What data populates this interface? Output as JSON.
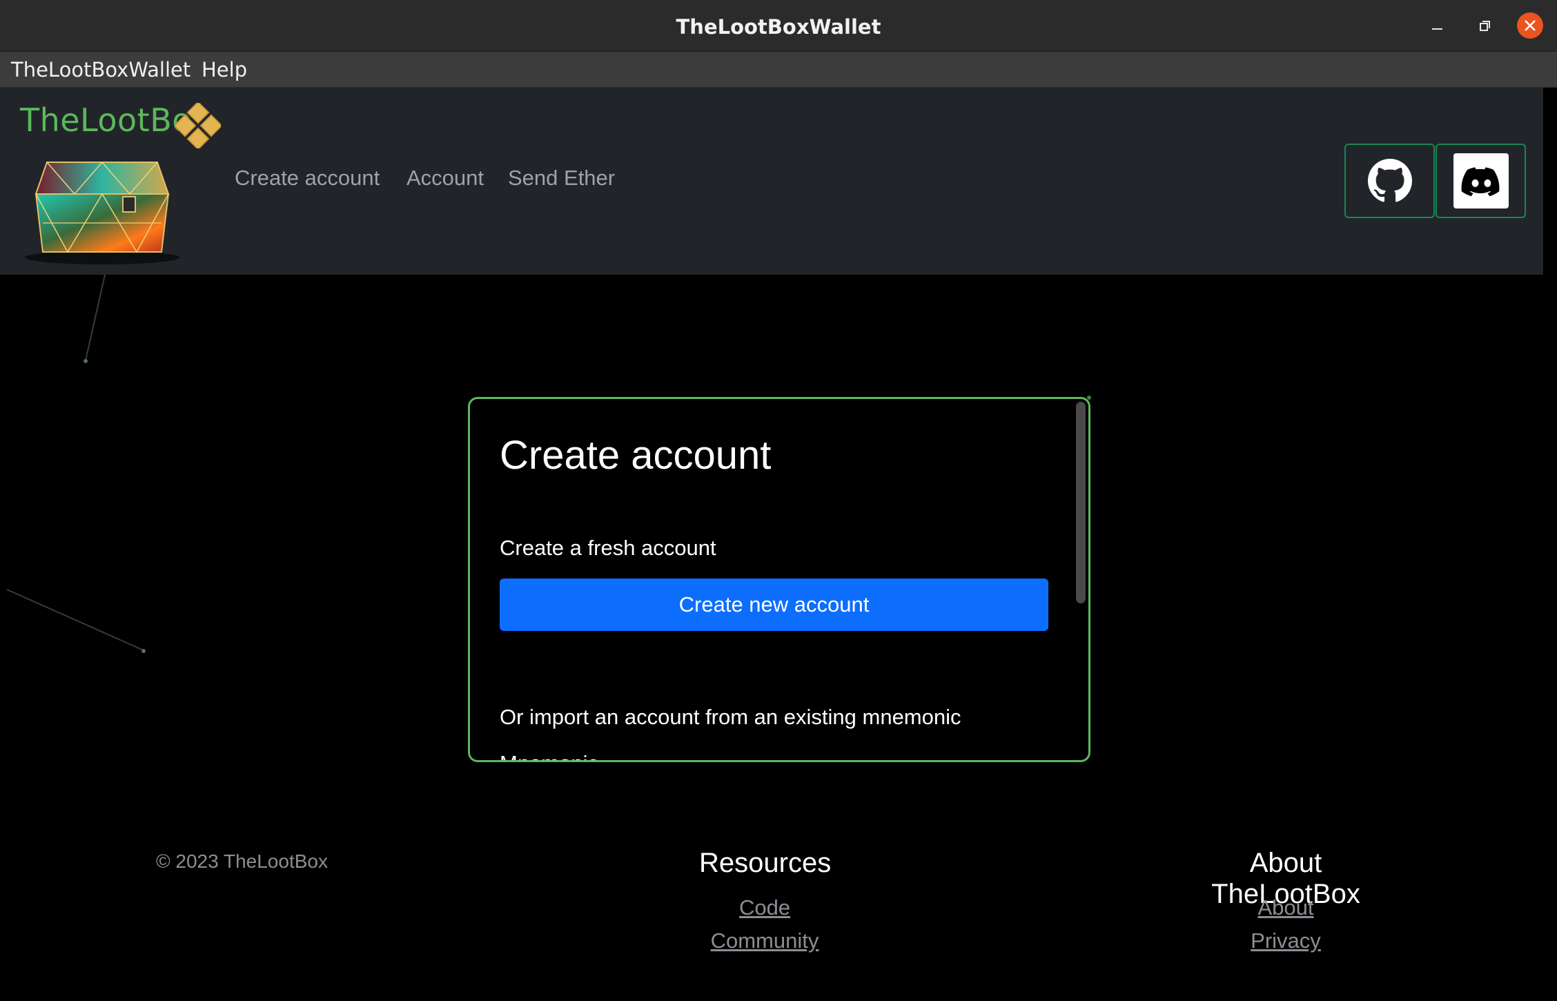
{
  "window": {
    "title": "TheLootBoxWallet"
  },
  "menubar": {
    "items": [
      {
        "label": "TheLootBoxWallet"
      },
      {
        "label": "Help"
      }
    ]
  },
  "navbar": {
    "brand": "TheLootBo",
    "links": [
      {
        "label": "Create account"
      },
      {
        "label": "Account"
      },
      {
        "label": "Send Ether"
      }
    ],
    "social": [
      {
        "icon": "github-icon"
      },
      {
        "icon": "discord-icon"
      }
    ],
    "accent_color": "#198754"
  },
  "card": {
    "title": "Create account",
    "fresh_label": "Create a fresh account",
    "create_button": "Create new account",
    "import_label": "Or import an account from an existing mnemonic",
    "mnemonic_label": "Mnemonic",
    "border_color": "#5cb85c",
    "button_color": "#0d6efd"
  },
  "footer": {
    "copyright": "© 2023 TheLootBox",
    "resources": {
      "heading": "Resources",
      "links": [
        {
          "label": "Code"
        },
        {
          "label": "Community"
        }
      ]
    },
    "about": {
      "heading": "About TheLootBox",
      "links": [
        {
          "label": "About"
        },
        {
          "label": "Privacy"
        }
      ]
    }
  }
}
